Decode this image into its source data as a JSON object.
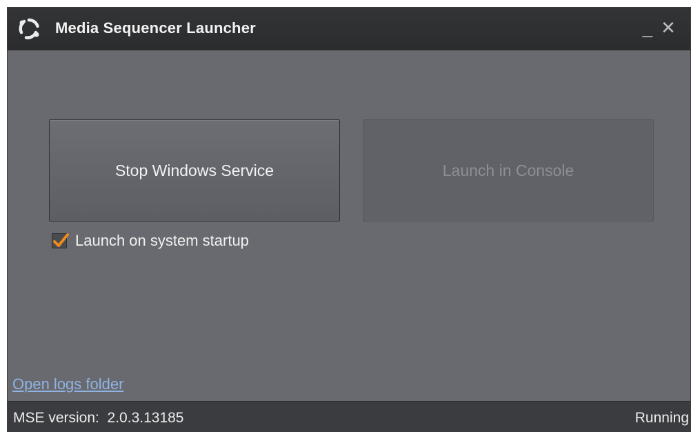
{
  "window": {
    "title": "Media Sequencer Launcher",
    "minimize_glyph": "_",
    "close_glyph": "✕",
    "icon": "refresh-cycle-icon"
  },
  "main": {
    "stop_service_label": "Stop Windows Service",
    "launch_console_label": "Launch in Console",
    "launch_console_enabled": false,
    "startup_checkbox": {
      "label": "Launch on system startup",
      "checked": true
    },
    "open_logs_label": "Open logs folder"
  },
  "statusbar": {
    "version_label": "MSE version:",
    "version_value": "2.0.3.13185",
    "status": "Running"
  },
  "colors": {
    "titlebar": "#2e2f31",
    "body": "#686a6f",
    "statusbar": "#3b3c3f",
    "check_accent": "#f08a1c",
    "link": "#8fb3e3"
  }
}
